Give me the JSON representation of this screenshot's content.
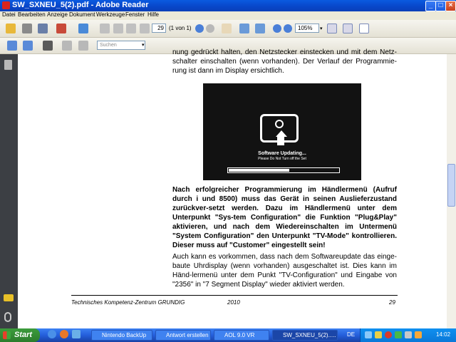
{
  "window": {
    "title": "SW_SXNEU_5(2).pdf - Adobe Reader"
  },
  "menu": [
    "Datei",
    "Bearbeiten",
    "Anzeige",
    "Dokument",
    "Werkzeuge",
    "Fenster",
    "Hilfe"
  ],
  "toolbar": {
    "page_value": "29",
    "page_count": "(1 von 1)",
    "zoom_value": "105%"
  },
  "search": {
    "placeholder": "Suchen"
  },
  "document": {
    "para_top": "nung gedrückt halten, den Netzstecker einstecken und mit dem Netz-schalter einschalten (wenn vorhanden). Der Verlauf der Programmie-rung ist dann im Display ersichtlich.",
    "figure": {
      "line1": "Software Updating...",
      "line2": "Please Do Not Turn off the Set",
      "progress": 0.55
    },
    "para_bold": "Nach erfolgreicher Programmierung im Händlermenü (Aufruf durch i und 8500) muss das Gerät in seinen Auslieferzustand zurückver-setzt werden. Dazu im Händlermenü unter dem Unterpunkt \"Sys-tem Configuration\" die Funktion \"Plug&Play\" aktivieren, und nach dem Wiedereinschalten im Untermenü \"System Configuration\" den Unterpunkt \"TV-Mode\" kontrollieren. Dieser muss auf \"Customer\" eingestellt sein!",
    "para_bottom": "Auch kann es vorkommen, dass nach dem Softwareupdate das einge-baute Uhrdisplay (wenn vorhanden) ausgeschaltet ist. Dies kann im Händ-lermenü unter dem Punkt \"TV-Configuration\" und  Eingabe von \"2356\" in \"7 Segment Display\" wieder aktiviert werden.",
    "footer": {
      "left": "Technisches Kompetenz-Zentrum GRUNDIG",
      "year": "2010",
      "page": "29"
    }
  },
  "taskbar": {
    "start": "Start",
    "buttons": [
      "Nintendo BackUp",
      "Antwort erstellen ...",
      "AOL 9.0 VR",
      "SW_SXNEU_5(2)....."
    ],
    "lang": "DE",
    "clock": "14:02"
  }
}
